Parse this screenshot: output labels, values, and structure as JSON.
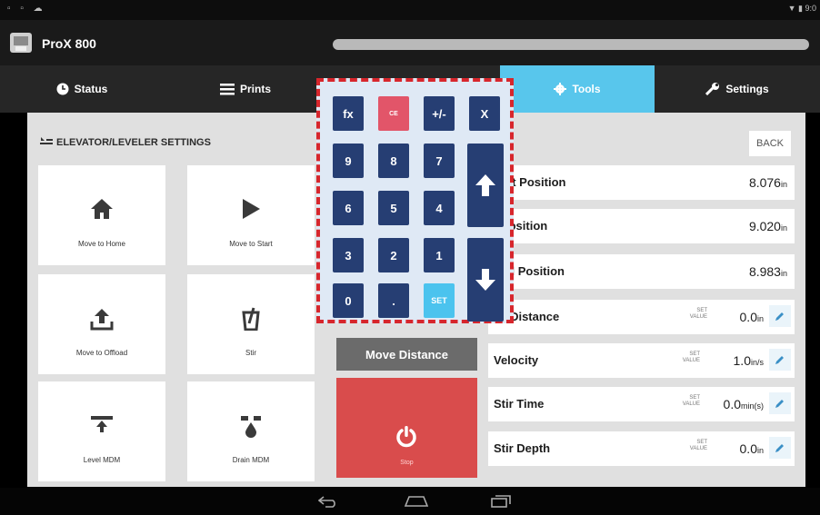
{
  "status_bar": {
    "left_icons": "▫ ▫ ☁",
    "right_text": "▼ ▮ 9:0"
  },
  "app": {
    "title": "ProX 800"
  },
  "tabs": [
    {
      "label": "Status",
      "icon": "clock-icon"
    },
    {
      "label": "Prints",
      "icon": "menu-icon"
    },
    {
      "label": "Tools",
      "icon": "gear-icon"
    },
    {
      "label": "Settings",
      "icon": "wrench-icon"
    }
  ],
  "section": {
    "title": "ELEVATOR/LEVELER SETTINGS",
    "icon": "elevator-icon"
  },
  "tiles": [
    {
      "label": "Move to Home",
      "icon": "home-icon"
    },
    {
      "label": "Move to Start",
      "icon": "play-icon"
    },
    {
      "label": "Move to Offload",
      "icon": "upload-icon"
    },
    {
      "label": "Stir",
      "icon": "stir-icon"
    },
    {
      "label": "Level MDM",
      "icon": "level-icon"
    },
    {
      "label": "Drain MDM",
      "icon": "drain-icon"
    }
  ],
  "keypad": {
    "top": [
      "fx",
      "CE",
      "+/-",
      "X"
    ],
    "digits": [
      "9",
      "8",
      "7",
      "6",
      "5",
      "4",
      "3",
      "2",
      "1",
      "0",
      "."
    ],
    "set": "SET",
    "up_icon": "arrow-up-icon",
    "down_icon": "arrow-down-icon"
  },
  "buttons": {
    "move_distance": "Move Distance",
    "stop": "Stop",
    "back": "BACK"
  },
  "rows": [
    {
      "name": "rent Position",
      "value": "8.076",
      "unit": "in"
    },
    {
      "name": "t Position",
      "value": "9.020",
      "unit": "in"
    },
    {
      "name": "oad Position",
      "value": "8.983",
      "unit": "in"
    },
    {
      "name": "ve Distance",
      "set_line1": "SET",
      "set_line2": "VALUE",
      "value": "0.0",
      "unit": "in"
    },
    {
      "name": "Velocity",
      "set_line1": "SET",
      "set_line2": "VALUE",
      "value": "1.0",
      "unit": "in/s"
    },
    {
      "name": "Stir Time",
      "set_line1": "SET",
      "set_line2": "VALUE",
      "value": "0.0",
      "unit": "min(s)"
    },
    {
      "name": "Stir Depth",
      "set_line1": "SET",
      "set_line2": "VALUE",
      "value": "0.0",
      "unit": "in"
    }
  ],
  "colors": {
    "accent_tab": "#58c6ec",
    "stop": "#d94c4c",
    "key": "#263e73",
    "key_ce": "#e25569",
    "key_set": "#4bc3ee",
    "overlay_border": "#d7262c"
  }
}
